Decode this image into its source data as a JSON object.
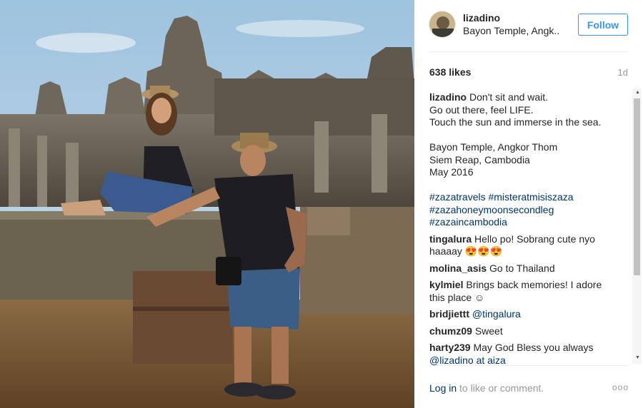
{
  "post": {
    "username": "lizadino",
    "location": "Bayon Temple, Angk..",
    "follow_label": "Follow",
    "likes": "638 likes",
    "age": "1d"
  },
  "caption": {
    "username": "lizadino",
    "lines": [
      "Don't sit and wait.",
      "Go out there, feel LIFE.",
      "Touch the sun and immerse in the sea.",
      "",
      "Bayon Temple, Angkor Thom",
      "Siem Reap, Cambodia",
      "May 2016",
      ""
    ],
    "hashtags": [
      "#zazatravels #misteratmisiszaza",
      "#zazahoneymoonsecondleg",
      "#zazaincambodia"
    ]
  },
  "comments": [
    {
      "user": "tingalura",
      "text": "Hello po! Sobrang cute nyo haaaay 😍😍😍"
    },
    {
      "user": "molina_asis",
      "text": "Go to Thailand"
    },
    {
      "user": "kylmiel",
      "text": "Brings back memories! I adore this place ☺"
    },
    {
      "user": "bridjiettt",
      "mention": "@tingalura",
      "text": ""
    },
    {
      "user": "chumz09",
      "text": "Sweet"
    },
    {
      "user": "harty239",
      "text": "May God Bless you always",
      "mention2": "@lizadino at aiza"
    }
  ],
  "footer": {
    "login_link": "Log in",
    "login_rest": " to like or comment.",
    "more_label": "ooo"
  },
  "colors": {
    "follow_blue": "#3897f0",
    "link_blue": "#003569",
    "muted": "#999999"
  },
  "icons": {
    "scroll_up": "triangle-up",
    "scroll_down": "triangle-down",
    "more": "ellipsis"
  }
}
